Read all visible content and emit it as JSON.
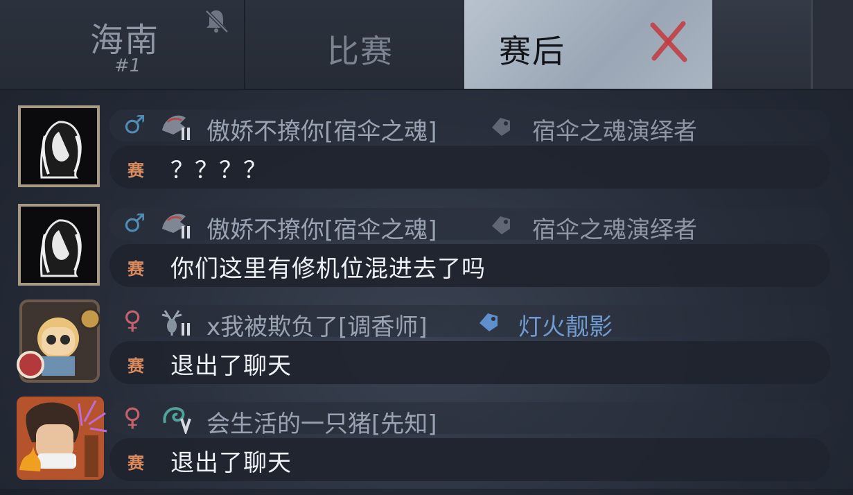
{
  "tabs": {
    "region": {
      "name": "海南",
      "rank": "#1",
      "muted_icon": "bell-muted-icon"
    },
    "match": {
      "label": "比赛"
    },
    "post": {
      "label": "赛后",
      "close_icon": "close-icon"
    }
  },
  "messages": [
    {
      "gender": "♂",
      "gender_type": "male",
      "name": "傲娇不撩你[宿伞之魂]",
      "tag": "宿伞之魂演绎者",
      "tag_color": "#8f97a5",
      "channel": "赛",
      "text": "？？？？",
      "rank_level": "II"
    },
    {
      "gender": "♂",
      "gender_type": "male",
      "name": "傲娇不撩你[宿伞之魂]",
      "tag": "宿伞之魂演绎者",
      "tag_color": "#8f97a5",
      "channel": "赛",
      "text": "你们这里有修机位混进去了吗",
      "rank_level": "II"
    },
    {
      "gender": "♀",
      "gender_type": "female",
      "name": "x我被欺负了[调香师]",
      "tag": "灯火靓影",
      "tag_color": "#6f9bd0",
      "channel": "赛",
      "text": "退出了聊天",
      "rank_level": "II"
    },
    {
      "gender": "♀",
      "gender_type": "female",
      "name": "会生活的一只猪[先知]",
      "tag": "",
      "tag_color": "",
      "channel": "赛",
      "text": "退出了聊天",
      "rank_level": "V"
    }
  ]
}
